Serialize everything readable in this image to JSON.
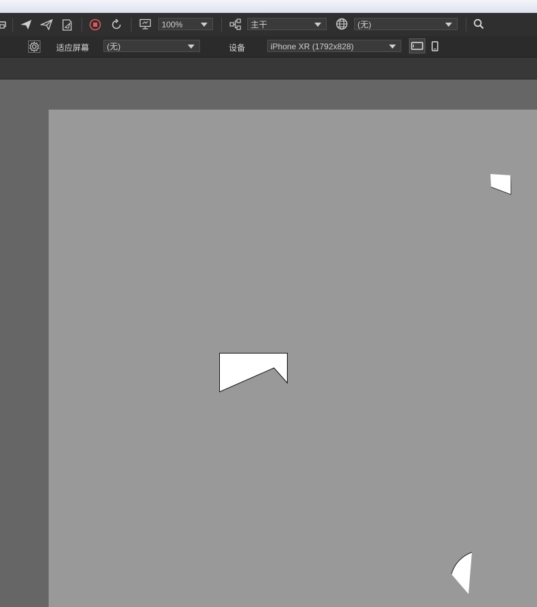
{
  "toolbar_top": {
    "zoom": {
      "value": "100%"
    },
    "branch": {
      "value": "主干"
    },
    "language": {
      "value": "(无)"
    }
  },
  "toolbar_second": {
    "fit_screen_label": "适应屏幕",
    "fit_screen_select": {
      "value": "(无)"
    },
    "device_label": "设备",
    "device_select": {
      "value": "iPhone XR (1792x828)"
    }
  },
  "colors": {
    "toolbar_bg": "#2f2f2f",
    "workspace_bg": "#666666",
    "page_bg": "#999999",
    "record_icon": "#e05a5a"
  },
  "icons": [
    "print-icon",
    "send-icon",
    "send-outline-icon",
    "export-page-icon",
    "record-stop-icon",
    "refresh-icon",
    "preview-monitor-icon",
    "branch-tree-icon",
    "globe-icon",
    "search-icon",
    "settings-gear-icon",
    "landscape-device-icon",
    "portrait-device-icon"
  ]
}
